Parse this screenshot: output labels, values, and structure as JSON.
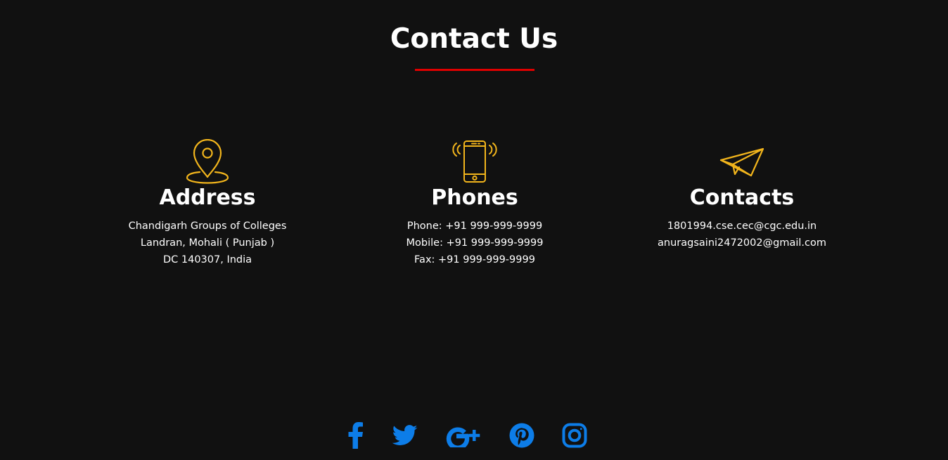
{
  "section": {
    "title": "Contact Us"
  },
  "colors": {
    "background": "#111111",
    "accent_line": "#e00000",
    "icon": "#f2b51c",
    "social": "#0d7de8",
    "text": "#ffffff"
  },
  "cards": [
    {
      "icon": "map-pin-icon",
      "heading": "Address",
      "lines": [
        "Chandigarh Groups of Colleges",
        "Landran, Mohali ( Punjab )",
        "DC 140307, India"
      ]
    },
    {
      "icon": "smartphone-icon",
      "heading": "Phones",
      "lines": [
        "Phone: +91 999-999-9999",
        "Mobile: +91 999-999-9999",
        "Fax: +91 999-999-9999"
      ]
    },
    {
      "icon": "paper-plane-icon",
      "heading": "Contacts",
      "lines": [
        "1801994.cse.cec@cgc.edu.in",
        "anuragsaini2472002@gmail.com"
      ]
    }
  ],
  "social": [
    "facebook-icon",
    "twitter-icon",
    "google-plus-icon",
    "pinterest-icon",
    "instagram-icon"
  ]
}
